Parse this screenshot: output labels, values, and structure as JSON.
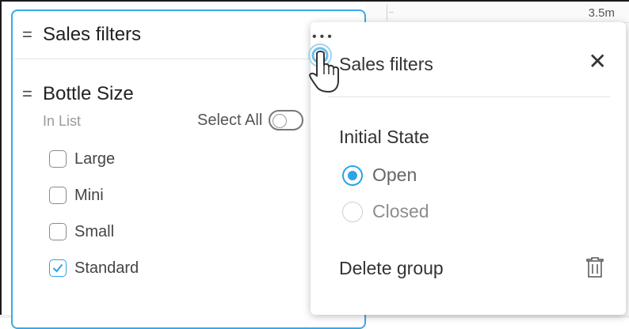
{
  "axis": {
    "value": "3.5m"
  },
  "filter_panel": {
    "title": "Sales filters",
    "group": {
      "title": "Bottle Size",
      "mode": "In List",
      "select_all_label": "Select All",
      "options": [
        {
          "label": "Large",
          "checked": false
        },
        {
          "label": "Mini",
          "checked": false
        },
        {
          "label": "Small",
          "checked": false
        },
        {
          "label": "Standard",
          "checked": true
        }
      ]
    }
  },
  "menu": {
    "title": "Sales filters",
    "initial_state_label": "Initial State",
    "options": [
      {
        "label": "Open",
        "selected": true
      },
      {
        "label": "Closed",
        "selected": false
      }
    ],
    "delete_label": "Delete group"
  },
  "colors": {
    "accent": "#2ea3e6",
    "panel_border": "#39a9e8"
  }
}
